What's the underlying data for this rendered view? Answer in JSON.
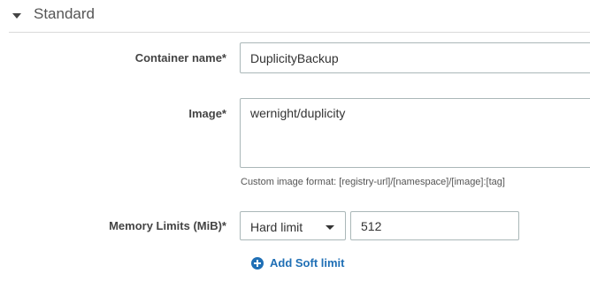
{
  "section": {
    "title": "Standard",
    "caret_icon": "caret-down-icon"
  },
  "fields": {
    "container_name": {
      "label": "Container name*",
      "value": "DuplicityBackup"
    },
    "image": {
      "label": "Image*",
      "value": "wernight/duplicity",
      "help": "Custom image format: [registry-url]/[namespace]/[image]:[tag]"
    },
    "memory_limits": {
      "label": "Memory Limits (MiB)*",
      "limit_type": "Hard limit",
      "value": "512"
    }
  },
  "add_soft_limit": {
    "label": "Add Soft limit",
    "icon": "plus-circle-icon",
    "color": "#1f6fb5"
  }
}
